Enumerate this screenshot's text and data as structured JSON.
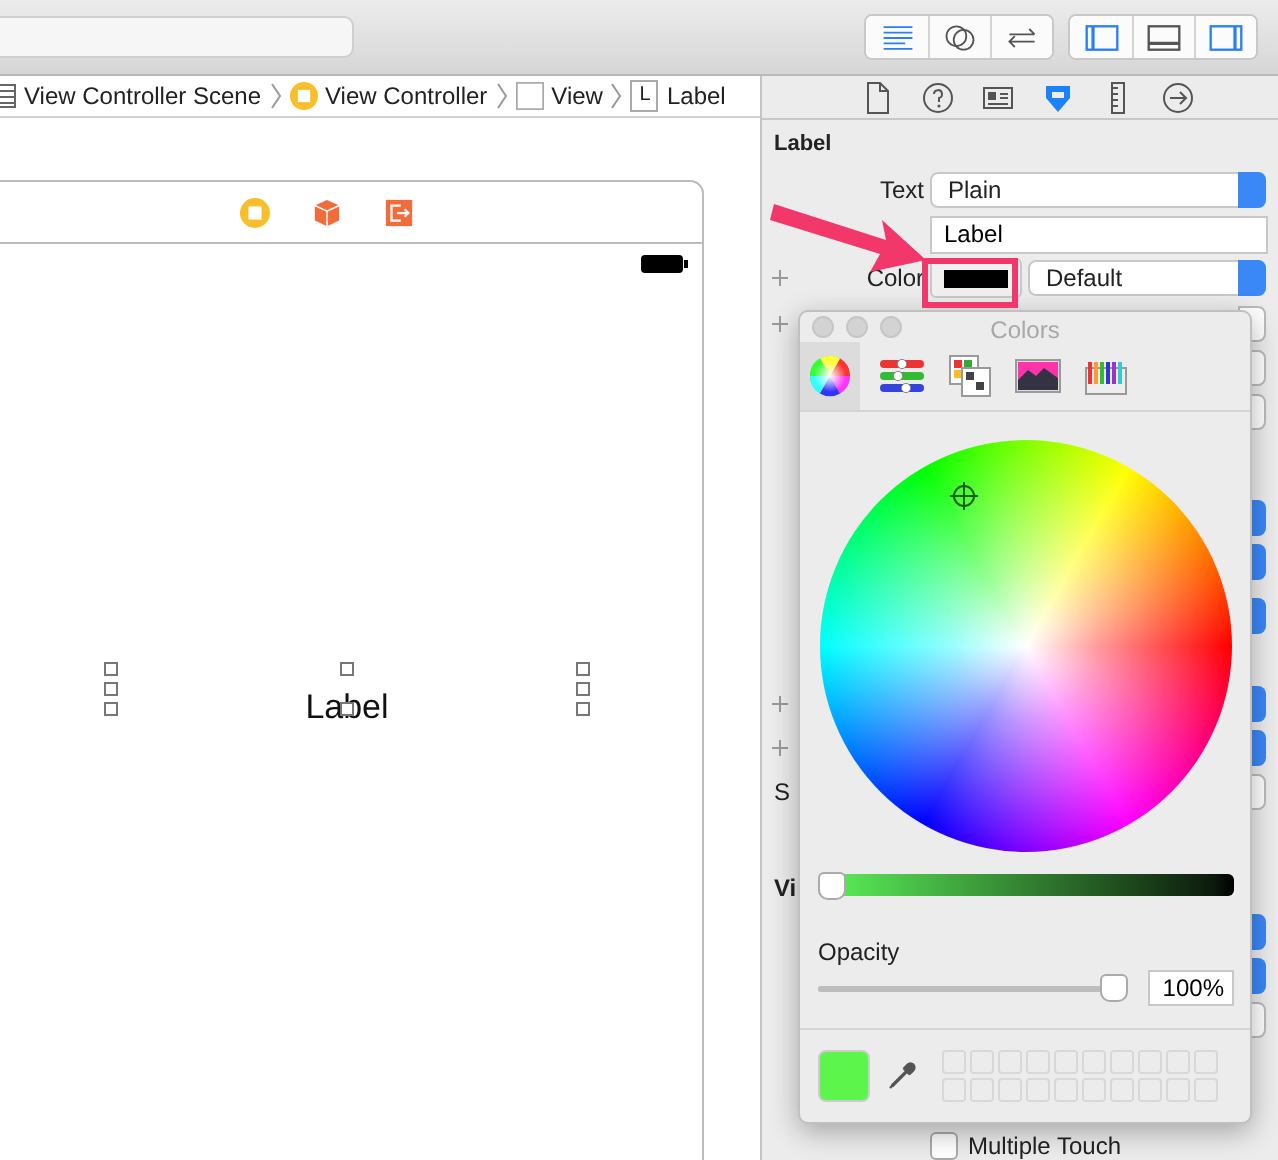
{
  "toolbar": {
    "editor_buttons": [
      {
        "kind": "standard",
        "selected": true
      },
      {
        "kind": "assistant",
        "selected": false
      },
      {
        "kind": "version",
        "selected": false
      }
    ],
    "area_buttons": [
      {
        "kind": "navigator",
        "selected": true
      },
      {
        "kind": "debug",
        "selected": false
      },
      {
        "kind": "utilities",
        "selected": true
      }
    ]
  },
  "breadcrumb": [
    {
      "kind": "scene",
      "label": "View Controller Scene"
    },
    {
      "kind": "controller",
      "label": "View Controller"
    },
    {
      "kind": "view",
      "label": "View"
    },
    {
      "kind": "label",
      "icon_text": "L",
      "label": "Label"
    }
  ],
  "inspector_tabs": [
    {
      "kind": "file",
      "selected": false
    },
    {
      "kind": "help",
      "selected": false
    },
    {
      "kind": "identity",
      "selected": false
    },
    {
      "kind": "attributes",
      "selected": true
    },
    {
      "kind": "size",
      "selected": false
    },
    {
      "kind": "connections",
      "selected": false
    }
  ],
  "canvas": {
    "label_text": "Label"
  },
  "inspector": {
    "section_title": "Label",
    "text_label": "Text",
    "text_popup": "Plain",
    "text_value": "Label",
    "color_label": "Color",
    "color_popup": "Default",
    "hidden_label": "S",
    "second_section_title": "Vi",
    "multiple_touch": {
      "label": "Multiple Touch",
      "checked": false
    }
  },
  "colors_panel": {
    "title": "Colors",
    "modes": [
      {
        "kind": "wheel",
        "selected": true
      },
      {
        "kind": "sliders",
        "selected": false
      },
      {
        "kind": "palettes",
        "selected": false
      },
      {
        "kind": "image",
        "selected": false
      },
      {
        "kind": "pencils",
        "selected": false
      }
    ],
    "brightness": {
      "level": 0.0
    },
    "opacity_label": "Opacity",
    "opacity": {
      "level": 1.0
    },
    "opacity_value": "100%"
  }
}
